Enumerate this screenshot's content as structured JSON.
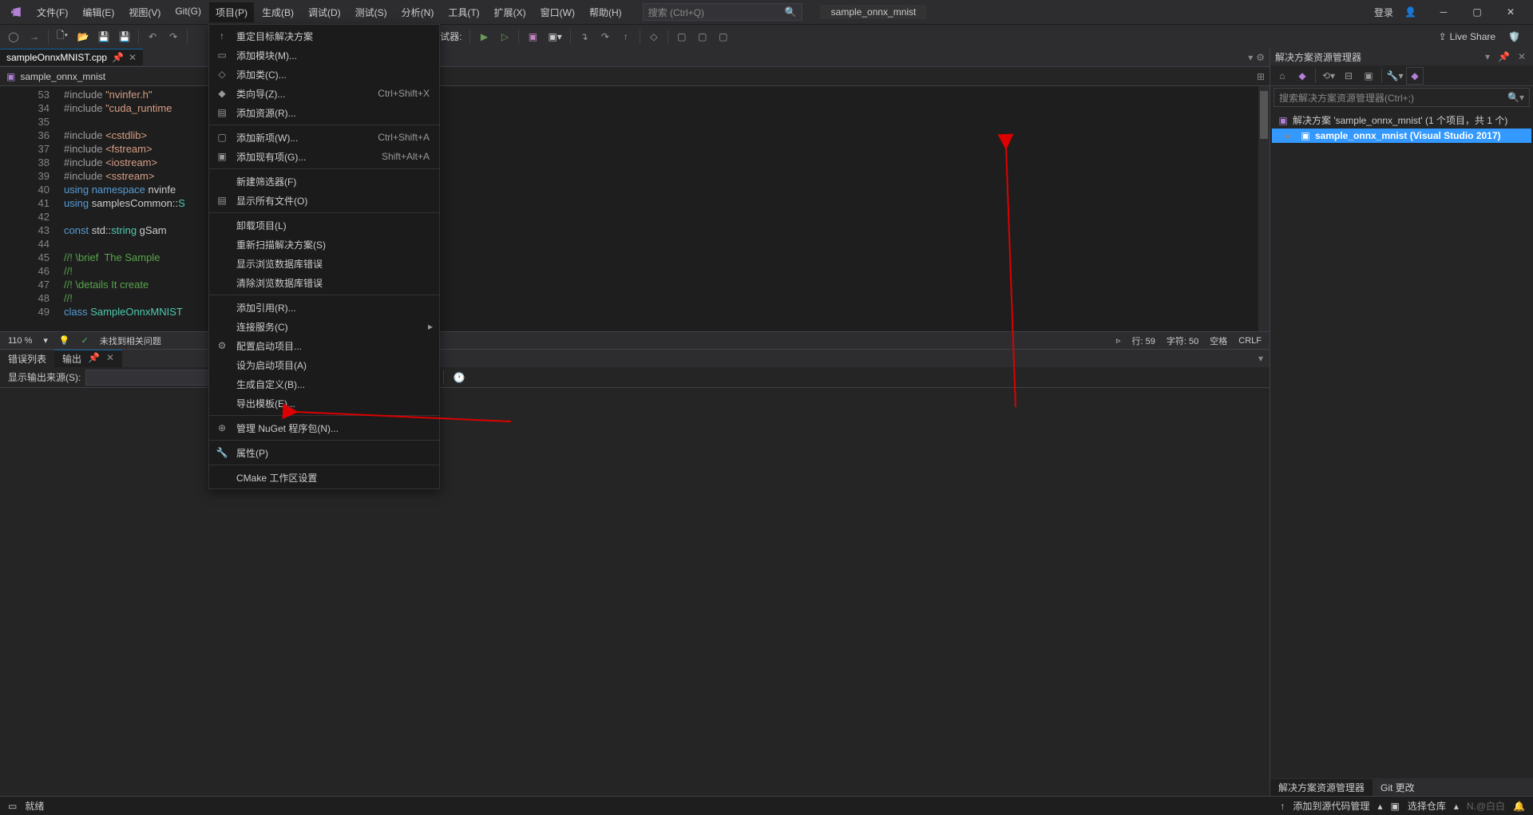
{
  "titlebar": {
    "menus": [
      "文件(F)",
      "编辑(E)",
      "视图(V)",
      "Git(G)",
      "项目(P)",
      "生成(B)",
      "调试(D)",
      "测试(S)",
      "分析(N)",
      "工具(T)",
      "扩展(X)",
      "窗口(W)",
      "帮助(H)"
    ],
    "search_placeholder": "搜索 (Ctrl+Q)",
    "doc_name": "sample_onnx_mnist",
    "login": "登录",
    "liveshare": "Live Share"
  },
  "toolbar": {
    "debugger_label": "调试器:"
  },
  "editor": {
    "tab_name": "sampleOnnxMNIST.cpp",
    "nav_file": "sample_onnx_mnist",
    "line_numbers": [
      "53",
      "34",
      "35",
      "36",
      "37",
      "38",
      "39",
      "40",
      "41",
      "42",
      "43",
      "44",
      "45",
      "46",
      "47",
      "48",
      "49"
    ],
    "code_lines": [
      {
        "t": "#include <cuda_runtime"
      },
      {
        "t": ""
      },
      {
        "t": "#include <cstdlib>"
      },
      {
        "t": "#include <fstream>"
      },
      {
        "t": "#include <iostream>"
      },
      {
        "t": "#include <sstream>"
      },
      {
        "t": "using namespace nvinfe"
      },
      {
        "t": "using samplesCommon::S"
      },
      {
        "t": ""
      },
      {
        "t": "const std::string gSam"
      },
      {
        "t": ""
      },
      {
        "t": "//! \\brief  The Sample                                sample"
      },
      {
        "t": "//!"
      },
      {
        "t": "//! \\details It create"
      },
      {
        "t": "//!"
      },
      {
        "t": "class SampleOnnxMNIST"
      }
    ],
    "status": {
      "zoom": "110 %",
      "no_issues": "未找到相关问题",
      "line": "行: 59",
      "col": "字符: 50",
      "spaces": "空格",
      "crlf": "CRLF"
    }
  },
  "project_menu": [
    {
      "ico": "↑",
      "lbl": "重定目标解决方案",
      "sc": ""
    },
    {
      "ico": "▭",
      "lbl": "添加模块(M)...",
      "sc": ""
    },
    {
      "ico": "◇",
      "lbl": "添加类(C)...",
      "sc": ""
    },
    {
      "ico": "◆",
      "lbl": "类向导(Z)...",
      "sc": "Ctrl+Shift+X"
    },
    {
      "ico": "▤",
      "lbl": "添加资源(R)...",
      "sc": ""
    },
    {
      "sep": true
    },
    {
      "ico": "▢",
      "lbl": "添加新项(W)...",
      "sc": "Ctrl+Shift+A"
    },
    {
      "ico": "▣",
      "lbl": "添加现有项(G)...",
      "sc": "Shift+Alt+A"
    },
    {
      "sep": true
    },
    {
      "ico": "",
      "lbl": "新建筛选器(F)",
      "sc": ""
    },
    {
      "ico": "▤",
      "lbl": "显示所有文件(O)",
      "sc": ""
    },
    {
      "sep": true
    },
    {
      "ico": "",
      "lbl": "卸载项目(L)",
      "sc": ""
    },
    {
      "ico": "",
      "lbl": "重新扫描解决方案(S)",
      "sc": ""
    },
    {
      "ico": "",
      "lbl": "显示浏览数据库错误",
      "sc": ""
    },
    {
      "ico": "",
      "lbl": "清除浏览数据库错误",
      "sc": ""
    },
    {
      "sep": true
    },
    {
      "ico": "",
      "lbl": "添加引用(R)...",
      "sc": ""
    },
    {
      "ico": "",
      "lbl": "连接服务(C)",
      "sc": "",
      "arrow": true
    },
    {
      "ico": "⚙",
      "lbl": "配置启动项目...",
      "sc": ""
    },
    {
      "ico": "",
      "lbl": "设为启动项目(A)",
      "sc": ""
    },
    {
      "ico": "",
      "lbl": "生成自定义(B)...",
      "sc": ""
    },
    {
      "ico": "",
      "lbl": "导出模板(E)...",
      "sc": ""
    },
    {
      "sep": true
    },
    {
      "ico": "⊕",
      "lbl": "管理 NuGet 程序包(N)...",
      "sc": ""
    },
    {
      "sep": true
    },
    {
      "ico": "🔧",
      "lbl": "属性(P)",
      "sc": ""
    },
    {
      "sep": true
    },
    {
      "ico": "",
      "lbl": "CMake 工作区设置",
      "sc": ""
    }
  ],
  "output": {
    "tab_errors": "错误列表",
    "tab_output": "输出",
    "source_label": "显示输出来源(S):"
  },
  "solution": {
    "title": "解决方案资源管理器",
    "search_placeholder": "搜索解决方案资源管理器(Ctrl+;)",
    "root": "解决方案 'sample_onnx_mnist' (1 个项目，共 1 个)",
    "project": "sample_onnx_mnist (Visual Studio 2017)",
    "footer_tab1": "解决方案资源管理器",
    "footer_tab2": "Git 更改"
  },
  "statusbar": {
    "ready": "就绪",
    "source_control": "添加到源代码管理",
    "repo": "选择仓库",
    "watermark": "N.@白白"
  }
}
